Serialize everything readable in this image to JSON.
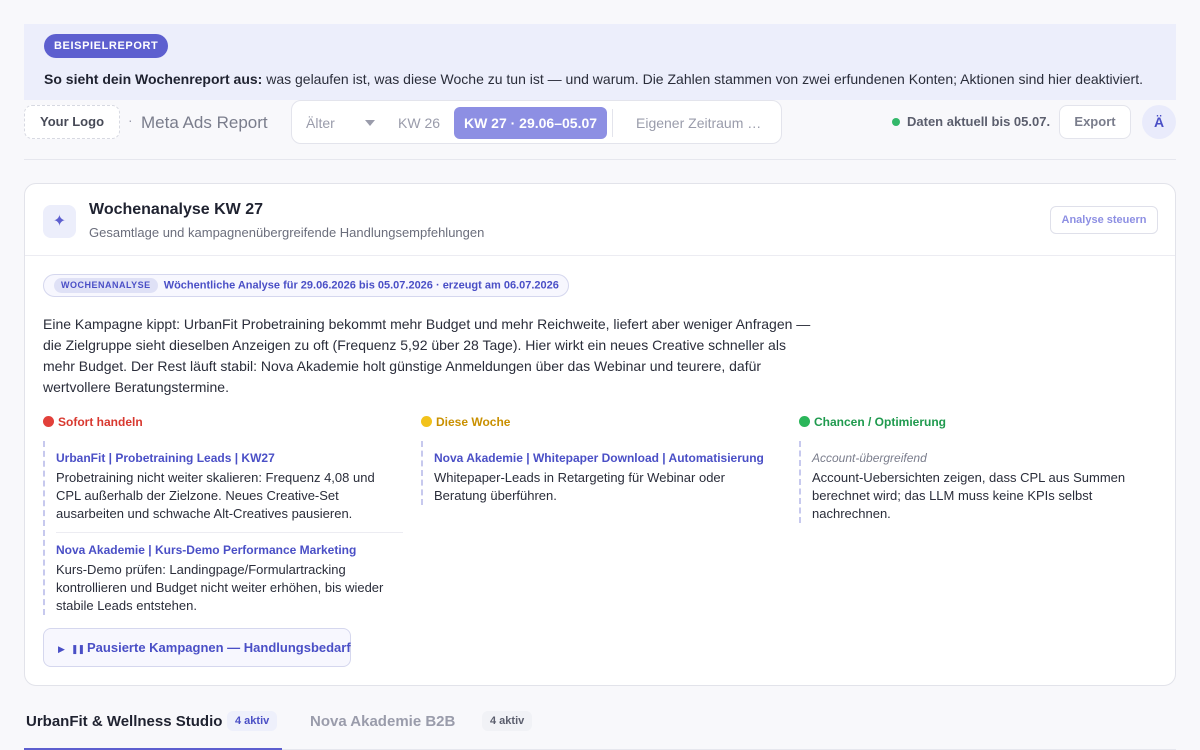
{
  "banner": {
    "badge": "BEISPIELREPORT",
    "lead": "So sieht dein Wochenreport aus:",
    "text": " was gelaufen ist, was diese Woche zu tun ist — und warum. Die Zahlen stammen von zwei erfundenen Konten; Aktionen sind hier deaktiviert."
  },
  "header": {
    "logo": "Your Logo",
    "separator": "·",
    "report_title": "Meta Ads Report",
    "period": {
      "older": "Älter",
      "kw26": "KW 26",
      "kw27": "KW 27 · 29.06–05.07",
      "custom": "Eigener Zeitraum …"
    },
    "status": "Daten aktuell bis 05.07.",
    "export": "Export",
    "lang": "Ä"
  },
  "analysis": {
    "icon": "sparkle-icon",
    "title": "Wochenanalyse KW 27",
    "subtitle": "Gesamtlage und kampagnenübergreifende Handlungsempfehlungen",
    "steer": "Analyse steuern",
    "meta_tag": "WOCHENANALYSE",
    "meta_text": "Wöchentliche Analyse für 29.06.2026 bis 05.07.2026 · erzeugt am 06.07.2026",
    "summary": "Eine Kampagne kippt: UrbanFit Probetraining bekommt mehr Budget und mehr Reichweite, liefert aber weniger Anfragen — die Zielgruppe sieht dieselben Anzeigen zu oft (Frequenz 5,92 über 28 Tage). Hier wirkt ein neues Creative schneller als mehr Budget. Der Rest läuft stabil: Nova Akademie holt günstige Anmeldungen über das Webinar und teurere, dafür wertvollere Beratungstermine.",
    "columns": {
      "urgent": {
        "label": "Sofort handeln",
        "color": "#e2403a",
        "items": [
          {
            "title": "UrbanFit | Probetraining Leads | KW27",
            "text": "Probetraining nicht weiter skalieren: Frequenz 4,08 und CPL außerhalb der Zielzone. Neues Creative-Set ausarbeiten und schwache Alt-Creatives pausieren."
          },
          {
            "title": "Nova Akademie | Kurs-Demo Performance Marketing",
            "text": "Kurs-Demo prüfen: Landingpage/Formulartracking kontrollieren und Budget nicht weiter erhöhen, bis wieder stabile Leads entstehen."
          }
        ]
      },
      "week": {
        "label": "Diese Woche",
        "color": "#f2c21b",
        "items": [
          {
            "title": "Nova Akademie | Whitepaper Download | Automatisierung",
            "text": "Whitepaper-Leads in Retargeting für Webinar oder Beratung überführen."
          }
        ]
      },
      "chances": {
        "label": "Chancen / Optimierung",
        "color": "#2bb65a",
        "items": [
          {
            "title": "Account-übergreifend",
            "text": "Account-Uebersichten zeigen, dass CPL aus Summen berechnet wird; das LLM muss keine KPIs selbst nachrechnen."
          }
        ]
      }
    },
    "paused_button": {
      "play_glyph": "▶",
      "pause_glyph": "❚❚",
      "label": "Pausierte Kampagnen — Handlungsbedarf"
    }
  },
  "accounts": {
    "tabs": [
      {
        "name": "UrbanFit & Wellness Studio",
        "count": "4 aktiv"
      },
      {
        "name": "Nova Akademie B2B",
        "count": "4 aktiv"
      }
    ]
  }
}
